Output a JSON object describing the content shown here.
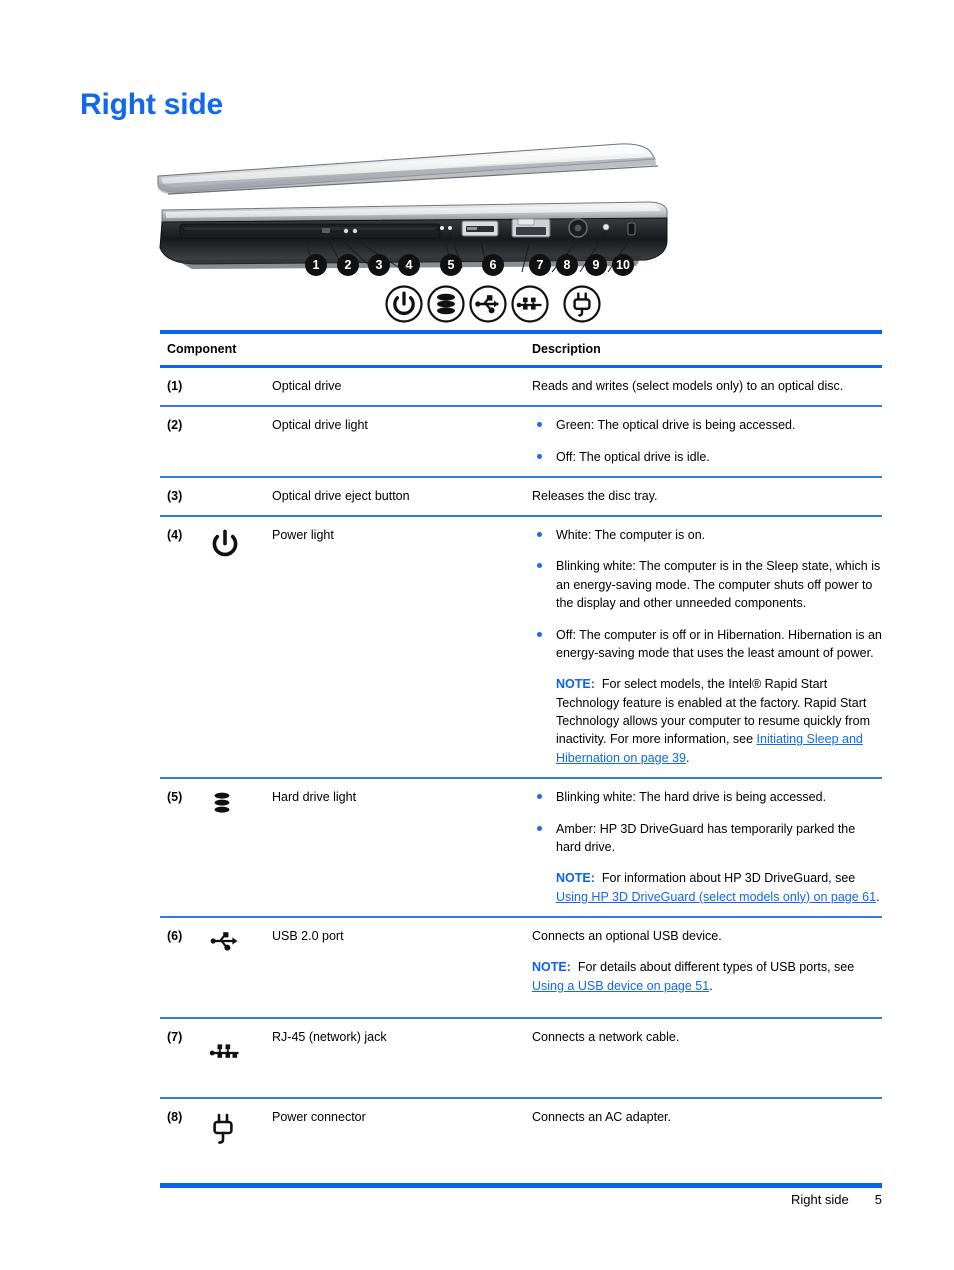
{
  "document": {
    "title": "Right side",
    "footer_section": "Right side",
    "footer_page": "5"
  },
  "colors": {
    "accent_blue": "#0a63e8",
    "title_blue": "#1168f0",
    "link_blue": "#1168f0",
    "bullet_blue": "#1a6fe0",
    "callout_fill": "#111111"
  },
  "illustration": {
    "name": "laptop-right-side-profile",
    "callouts": [
      "1",
      "2",
      "3",
      "4",
      "5",
      "6",
      "7",
      "8",
      "9",
      "10"
    ],
    "legend_icons": [
      "power-icon",
      "hard-drive-icon",
      "usb-icon",
      "rj45-network-icon",
      "power-connector-icon"
    ]
  },
  "table": {
    "headers": {
      "component": "Component",
      "description": "Description"
    },
    "rows": [
      {
        "num": "(1)",
        "icon": "",
        "label": "Optical drive",
        "desc_text": "Reads and writes (select models only) to an optical disc."
      },
      {
        "num": "(2)",
        "icon": "",
        "label": "Optical drive light",
        "bullets": [
          "Green: The optical drive is being accessed.",
          "Off: The optical drive is idle."
        ]
      },
      {
        "num": "(3)",
        "icon": "",
        "label": "Optical drive eject button",
        "desc_text": "Releases the disc tray."
      },
      {
        "num": "(4)",
        "icon": "power-icon",
        "label": "Power light",
        "bullets": [
          "White: The computer is on.",
          "Blinking white: The computer is in the Sleep state, which is an energy-saving mode. The computer shuts off power to the display and other unneeded components.",
          "Off: The computer is off or in Hibernation. Hibernation is an energy-saving mode that uses the least amount of power."
        ],
        "note": {
          "label": "NOTE:",
          "text_before": "For select models, the Intel® Rapid Start Technology feature is enabled at the factory. Rapid Start Technology allows your computer to resume quickly from inactivity. For more information, see ",
          "link": "Initiating Sleep and Hibernation on page 39",
          "text_after": "."
        }
      },
      {
        "num": "(5)",
        "icon": "hard-drive-icon",
        "label": "Hard drive light",
        "bullets": [
          "Blinking white: The hard drive is being accessed.",
          "Amber: HP 3D DriveGuard has temporarily parked the hard drive."
        ],
        "note": {
          "label": "NOTE:",
          "text_before": "For information about HP 3D DriveGuard, see ",
          "link": "Using HP 3D DriveGuard (select models only) on page 61",
          "text_after": "."
        }
      },
      {
        "num": "(6)",
        "icon": "usb-icon",
        "label": "USB 2.0 port",
        "desc_text": "Connects an optional USB device.",
        "note": {
          "label": "NOTE:",
          "text_before": "For details about different types of USB ports, see ",
          "link": "Using a USB device on page 51",
          "text_after": "."
        }
      },
      {
        "num": "(7)",
        "icon": "rj45-network-icon",
        "label": "RJ-45 (network) jack",
        "desc_text": "Connects a network cable."
      },
      {
        "num": "(8)",
        "icon": "power-connector-icon",
        "label": "Power connector",
        "desc_text": "Connects an AC adapter."
      }
    ]
  }
}
